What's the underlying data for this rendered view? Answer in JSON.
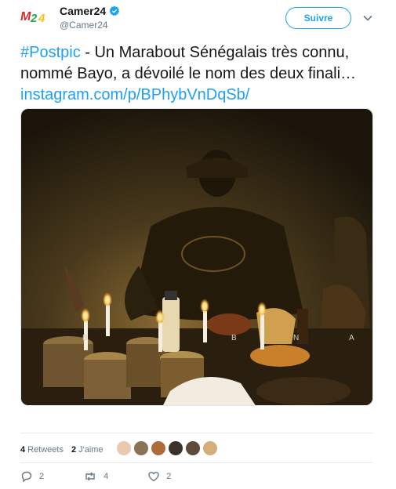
{
  "user": {
    "name": "Camer24",
    "handle": "@Camer24",
    "logo_text": "M24"
  },
  "follow": {
    "label": "Suivre"
  },
  "tweet": {
    "hashtag": "#Postpic",
    "body": " - Un Marabout Sénégalais très connu, nommé Bayo, a dévoilé le nom des deux finali… ",
    "link": "instagram.com/p/BPhybVnDqSb/"
  },
  "media": {
    "watermark_left": "B",
    "watermark_mid": "B",
    "watermark_n": "N",
    "watermark_a": "A"
  },
  "stats": {
    "retweets_count": "4",
    "retweets_label": "Retweets",
    "likes_count": "2",
    "likes_label": "J'aime"
  },
  "actions": {
    "reply_count": "2",
    "retweet_count": "4",
    "like_count": "2"
  },
  "colors": {
    "accent": "#1da1f2",
    "secondary_text": "#657786"
  }
}
